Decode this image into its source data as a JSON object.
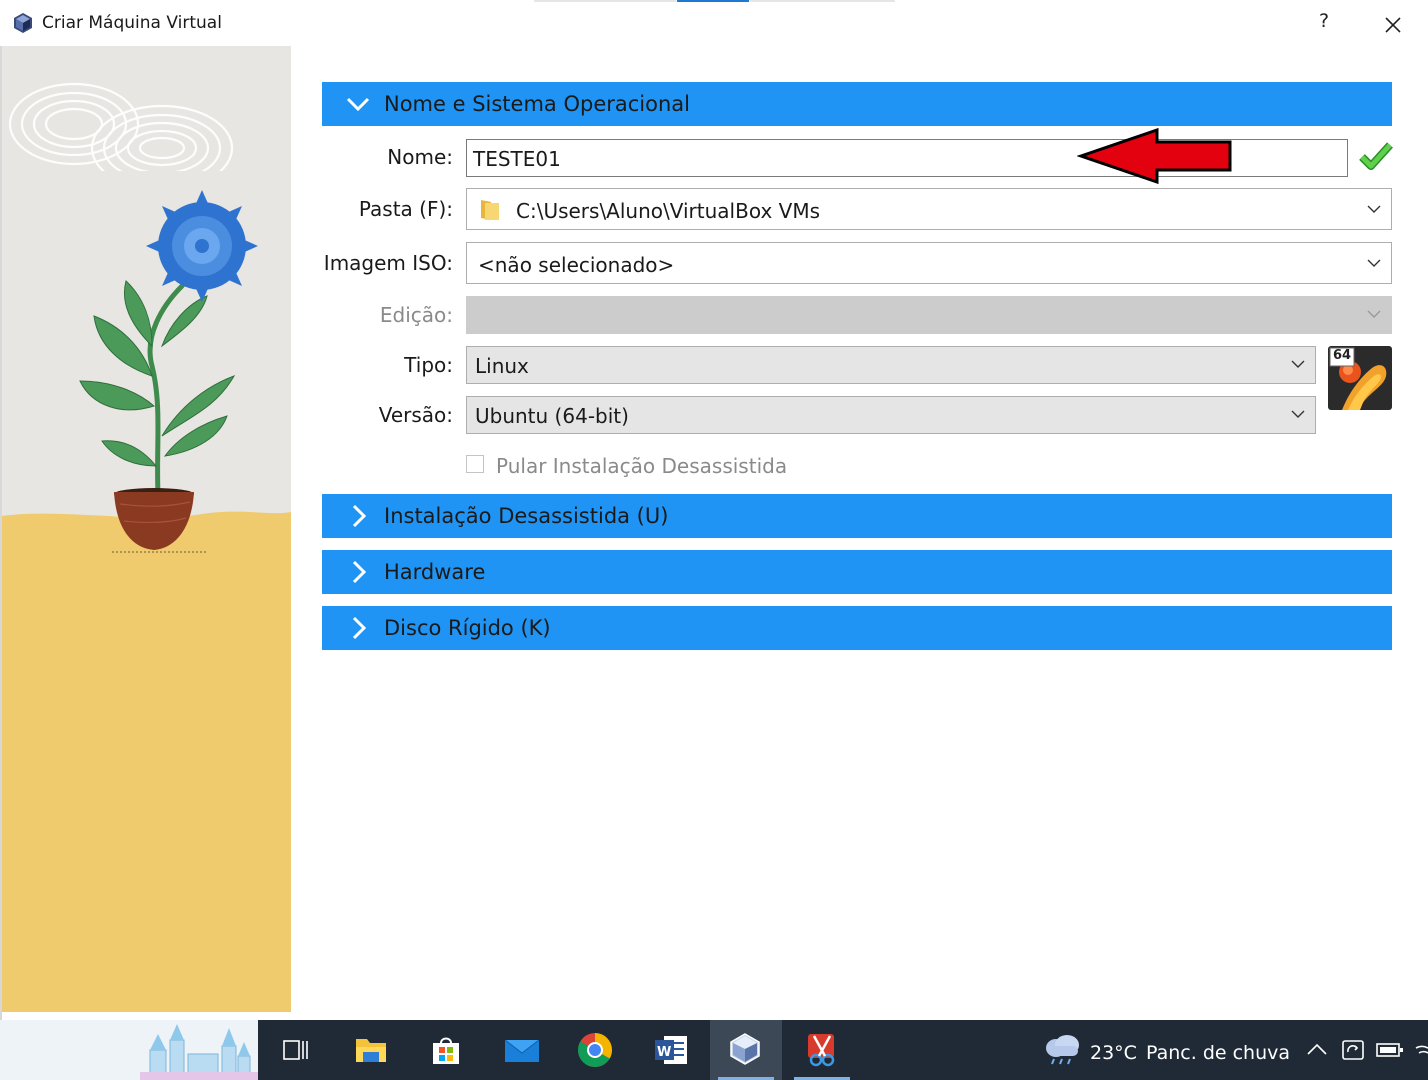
{
  "window": {
    "title": "Criar Máquina Virtual",
    "help_label": "?"
  },
  "sections": {
    "name_os": {
      "label": "Nome e Sistema Operacional"
    },
    "unattended": {
      "label": "Instalação Desassistida (U)"
    },
    "hardware": {
      "label": "Hardware"
    },
    "disk": {
      "label": "Disco Rígido (K)"
    }
  },
  "form": {
    "name": {
      "label": "Nome:",
      "value": "TESTE01"
    },
    "folder": {
      "label": "Pasta (F):",
      "value": "C:\\Users\\Aluno\\VirtualBox VMs"
    },
    "iso": {
      "label": "Imagem ISO:",
      "value": "<não selecionado>"
    },
    "edition": {
      "label": "Edição:",
      "value": ""
    },
    "type": {
      "label": "Tipo:",
      "value": "Linux"
    },
    "version": {
      "label": "Versão:",
      "value": "Ubuntu (64-bit)"
    },
    "skip_unattended": {
      "label": "Pular Instalação Desassistida",
      "checked": false
    },
    "os_badge": "64"
  },
  "taskbar": {
    "temperature": "23°C",
    "weather": "Panc. de chuva"
  },
  "colors": {
    "section_header": "#1f94f4",
    "taskbar": "#1f2a36",
    "panel_wall": "#e8e6e2",
    "panel_floor": "#efcb6e",
    "valid_check": "#3dbb3a",
    "annotation_arrow": "#e3000f"
  }
}
